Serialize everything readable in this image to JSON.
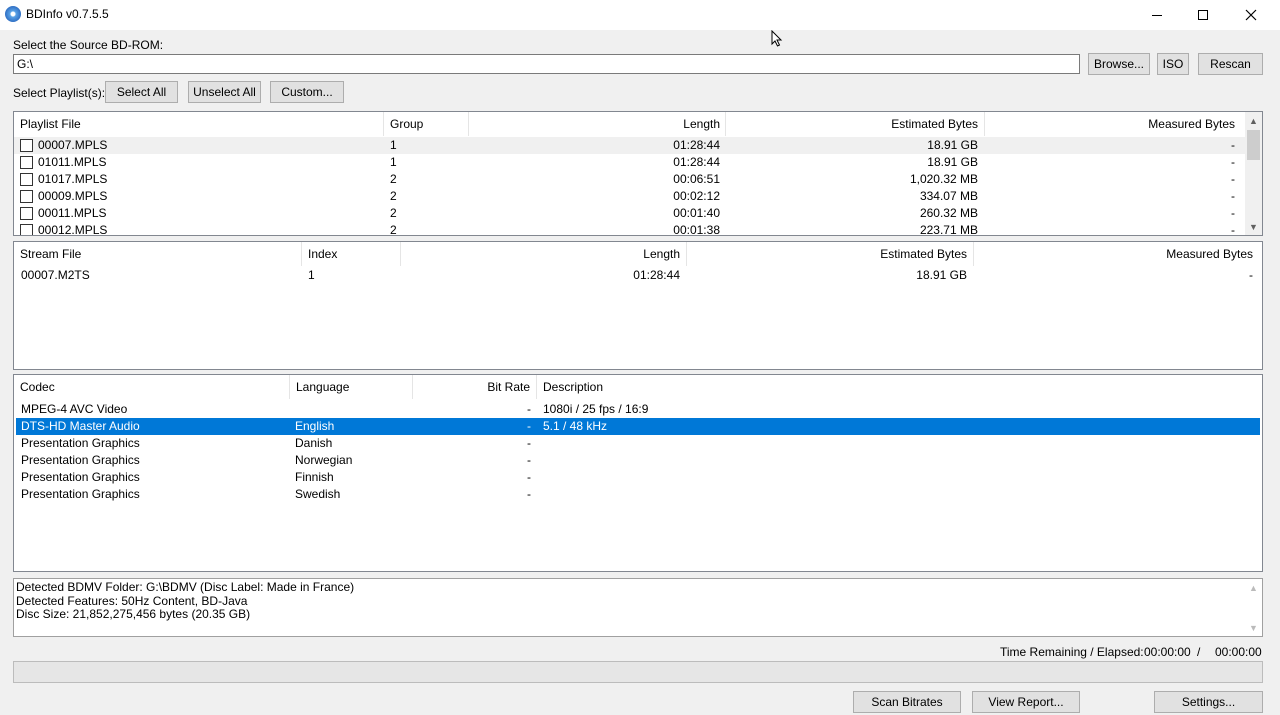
{
  "window": {
    "title": "BDInfo v0.7.5.5"
  },
  "source": {
    "label": "Select the Source BD-ROM:",
    "path": "G:\\"
  },
  "buttons": {
    "browse": "Browse...",
    "iso": "ISO",
    "rescan": "Rescan",
    "select_all": "Select All",
    "unselect_all": "Unselect All",
    "custom": "Custom...",
    "scan_bitrates": "Scan Bitrates",
    "view_report": "View Report...",
    "settings": "Settings..."
  },
  "playlists": {
    "label": "Select Playlist(s):",
    "columns": [
      "Playlist File",
      "Group",
      "Length",
      "Estimated Bytes",
      "Measured Bytes"
    ],
    "rows": [
      {
        "file": "00007.MPLS",
        "group": "1",
        "length": "01:28:44",
        "est": "18.91 GB",
        "measured": "-"
      },
      {
        "file": "01011.MPLS",
        "group": "1",
        "length": "01:28:44",
        "est": "18.91 GB",
        "measured": "-"
      },
      {
        "file": "01017.MPLS",
        "group": "2",
        "length": "00:06:51",
        "est": "1,020.32 MB",
        "measured": "-"
      },
      {
        "file": "00009.MPLS",
        "group": "2",
        "length": "00:02:12",
        "est": "334.07 MB",
        "measured": "-"
      },
      {
        "file": "00011.MPLS",
        "group": "2",
        "length": "00:01:40",
        "est": "260.32 MB",
        "measured": "-"
      },
      {
        "file": "00012.MPLS",
        "group": "2",
        "length": "00:01:38",
        "est": "223.71 MB",
        "measured": "-"
      }
    ]
  },
  "streams": {
    "columns": [
      "Stream File",
      "Index",
      "Length",
      "Estimated Bytes",
      "Measured Bytes"
    ],
    "rows": [
      {
        "file": "00007.M2TS",
        "index": "1",
        "length": "01:28:44",
        "est": "18.91 GB",
        "measured": "-"
      }
    ]
  },
  "codecs": {
    "columns": [
      "Codec",
      "Language",
      "Bit Rate",
      "Description"
    ],
    "rows": [
      {
        "codec": "MPEG-4 AVC Video",
        "language": "",
        "bitrate": "-",
        "desc": "1080i / 25 fps / 16:9"
      },
      {
        "codec": "DTS-HD Master Audio",
        "language": "English",
        "bitrate": "-",
        "desc": "5.1 / 48 kHz"
      },
      {
        "codec": "Presentation Graphics",
        "language": "Danish",
        "bitrate": "-",
        "desc": ""
      },
      {
        "codec": "Presentation Graphics",
        "language": "Norwegian",
        "bitrate": "-",
        "desc": ""
      },
      {
        "codec": "Presentation Graphics",
        "language": "Finnish",
        "bitrate": "-",
        "desc": ""
      },
      {
        "codec": "Presentation Graphics",
        "language": "Swedish",
        "bitrate": "-",
        "desc": ""
      }
    ]
  },
  "info": {
    "lines": [
      "Detected BDMV Folder: G:\\BDMV (Disc Label: Made in France)",
      "Detected Features: 50Hz Content, BD-Java",
      "Disc Size: 21,852,275,456 bytes (20.35 GB)"
    ]
  },
  "time": {
    "label": "Time Remaining / Elapsed:",
    "remaining": "00:00:00",
    "sep": "/",
    "elapsed": "00:00:00"
  },
  "progress": {
    "value": 0
  },
  "colors": {
    "selection": "#0078d7"
  },
  "icons": [
    "app-disc-icon",
    "minimize-icon",
    "maximize-icon",
    "close-icon",
    "scroll-up-icon",
    "scroll-down-icon",
    "checkbox-icon"
  ]
}
